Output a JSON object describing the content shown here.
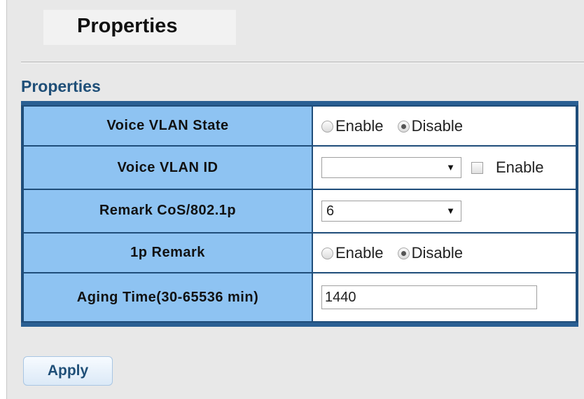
{
  "header": {
    "title": "Properties"
  },
  "section": {
    "title": "Properties"
  },
  "rows": [
    {
      "label": "Voice VLAN State",
      "type": "radio",
      "options": [
        "Enable",
        "Disable"
      ],
      "selected": "Disable"
    },
    {
      "label": "Voice VLAN ID",
      "type": "select_checkbox",
      "select_value": "",
      "checkbox_label": "Enable",
      "checked": false
    },
    {
      "label": "Remark CoS/802.1p",
      "type": "select",
      "select_value": "6"
    },
    {
      "label": "1p Remark",
      "type": "radio",
      "options": [
        "Enable",
        "Disable"
      ],
      "selected": "Disable"
    },
    {
      "label": "Aging Time(30-65536 min)",
      "type": "text",
      "value": "1440"
    }
  ],
  "actions": {
    "apply_label": "Apply"
  },
  "icons": {
    "dropdown": "triangle-down-icon"
  },
  "colors": {
    "label_bg": "#8ec3f2",
    "table_border": "#1f4d7a",
    "section_title": "#1f4f78"
  }
}
